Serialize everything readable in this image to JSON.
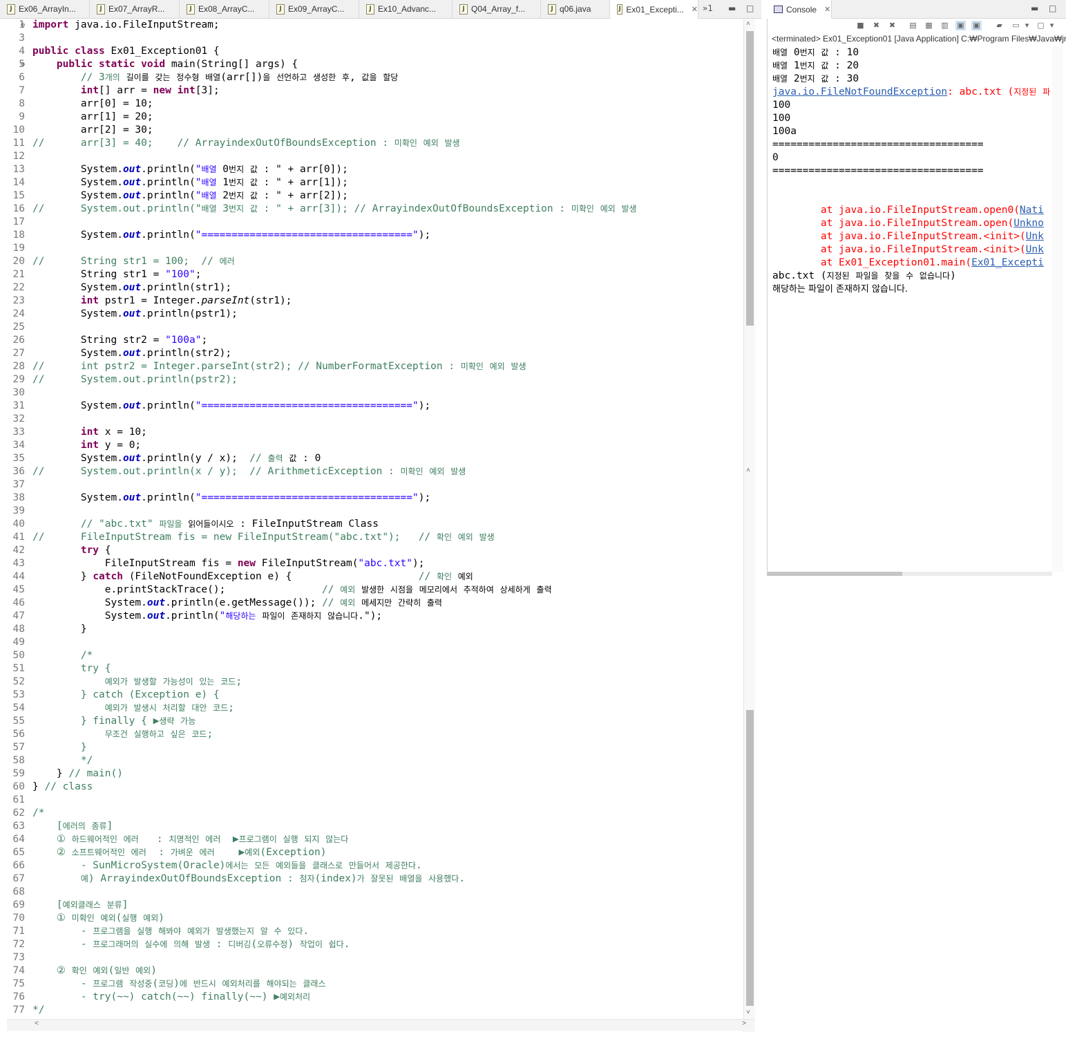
{
  "editor": {
    "tabs": [
      {
        "label": "Ex06_ArrayIn...",
        "active": false
      },
      {
        "label": "Ex07_ArrayR...",
        "active": false
      },
      {
        "label": "Ex08_ArrayC...",
        "active": false
      },
      {
        "label": "Ex09_ArrayC...",
        "active": false
      },
      {
        "label": "Ex10_Advanc...",
        "active": false
      },
      {
        "label": "Q04_Array_f...",
        "active": false
      },
      {
        "label": "q06.java",
        "active": false
      },
      {
        "label": "Ex01_Excepti...",
        "active": true
      }
    ],
    "overflow_label": "»1",
    "tab_close_glyph": "✕",
    "lines": [
      {
        "n": "1",
        "t": "import java.io.FileInputStream;"
      },
      {
        "n": "3",
        "t": ""
      },
      {
        "n": "4",
        "t": "public class Ex01_Exception01 {"
      },
      {
        "n": "5",
        "t": "    public static void main(String[] args) {"
      },
      {
        "n": "6",
        "t": "        // 3개의 길이를 갖는 정수형 배열(arr[])을 선언하고 생성한 후, 값을 할당"
      },
      {
        "n": "7",
        "t": "        int[] arr = new int[3];"
      },
      {
        "n": "8",
        "t": "        arr[0] = 10;"
      },
      {
        "n": "9",
        "t": "        arr[1] = 20;"
      },
      {
        "n": "10",
        "t": "        arr[2] = 30;"
      },
      {
        "n": "11",
        "t": "//      arr[3] = 40;    // ArrayindexOutOfBoundsException : 미확인 예외 발생"
      },
      {
        "n": "12",
        "t": ""
      },
      {
        "n": "13",
        "t": "        System.out.println(\"배열 0번지 값 : \" + arr[0]);"
      },
      {
        "n": "14",
        "t": "        System.out.println(\"배열 1번지 값 : \" + arr[1]);"
      },
      {
        "n": "15",
        "t": "        System.out.println(\"배열 2번지 값 : \" + arr[2]);"
      },
      {
        "n": "16",
        "t": "//      System.out.println(\"배열 3번지 값 : \" + arr[3]); // ArrayindexOutOfBoundsException : 미확인 예외 발생"
      },
      {
        "n": "17",
        "t": ""
      },
      {
        "n": "18",
        "t": "        System.out.println(\"===================================\");"
      },
      {
        "n": "19",
        "t": ""
      },
      {
        "n": "20",
        "t": "//      String str1 = 100;  // 에러"
      },
      {
        "n": "21",
        "t": "        String str1 = \"100\";"
      },
      {
        "n": "22",
        "t": "        System.out.println(str1);"
      },
      {
        "n": "23",
        "t": "        int pstr1 = Integer.parseInt(str1);"
      },
      {
        "n": "24",
        "t": "        System.out.println(pstr1);"
      },
      {
        "n": "25",
        "t": ""
      },
      {
        "n": "26",
        "t": "        String str2 = \"100a\";"
      },
      {
        "n": "27",
        "t": "        System.out.println(str2);"
      },
      {
        "n": "28",
        "t": "//      int pstr2 = Integer.parseInt(str2); // NumberFormatException : 미확인 예외 발생"
      },
      {
        "n": "29",
        "t": "//      System.out.println(pstr2);"
      },
      {
        "n": "30",
        "t": ""
      },
      {
        "n": "31",
        "t": "        System.out.println(\"===================================\");"
      },
      {
        "n": "32",
        "t": ""
      },
      {
        "n": "33",
        "t": "        int x = 10;"
      },
      {
        "n": "34",
        "t": "        int y = 0;"
      },
      {
        "n": "35",
        "t": "        System.out.println(y / x);  // 출력 값 : 0"
      },
      {
        "n": "36",
        "t": "//      System.out.println(x / y);  // ArithmeticException : 미확인 예외 발생"
      },
      {
        "n": "37",
        "t": ""
      },
      {
        "n": "38",
        "t": "        System.out.println(\"===================================\");"
      },
      {
        "n": "39",
        "t": ""
      },
      {
        "n": "40",
        "t": "        // \"abc.txt\" 파일을 읽어들이시오 : FileInputStream Class"
      },
      {
        "n": "41",
        "t": "//      FileInputStream fis = new FileInputStream(\"abc.txt\");   // 확인 예외 발생"
      },
      {
        "n": "42",
        "t": "        try {"
      },
      {
        "n": "43",
        "t": "            FileInputStream fis = new FileInputStream(\"abc.txt\");"
      },
      {
        "n": "44",
        "t": "        } catch (FileNotFoundException e) {                     // 확인 예외"
      },
      {
        "n": "45",
        "t": "            e.printStackTrace();                // 예외 발생한 시점을 메모리에서 추적하여 상세하게 출력"
      },
      {
        "n": "46",
        "t": "            System.out.println(e.getMessage()); // 예외 메세지만 간략히 출력"
      },
      {
        "n": "47",
        "t": "            System.out.println(\"해당하는 파일이 존재하지 않습니다.\");"
      },
      {
        "n": "48",
        "t": "        }"
      },
      {
        "n": "49",
        "t": ""
      },
      {
        "n": "50",
        "t": "        /*"
      },
      {
        "n": "51",
        "t": "        try {"
      },
      {
        "n": "52",
        "t": "            예외가 발생할 가능성이 있는 코드;"
      },
      {
        "n": "53",
        "t": "        } catch (Exception e) {"
      },
      {
        "n": "54",
        "t": "            예외가 발생시 처리할 대안 코드;"
      },
      {
        "n": "55",
        "t": "        } finally { ▶생략 가능"
      },
      {
        "n": "56",
        "t": "            무조건 실행하고 싶은 코드;"
      },
      {
        "n": "57",
        "t": "        }"
      },
      {
        "n": "58",
        "t": "        */"
      },
      {
        "n": "59",
        "t": "    } // main()"
      },
      {
        "n": "60",
        "t": "} // class"
      },
      {
        "n": "61",
        "t": ""
      },
      {
        "n": "62",
        "t": "/*"
      },
      {
        "n": "63",
        "t": "    [에러의 종류]"
      },
      {
        "n": "64",
        "t": "    ① 하드웨어적인 에러   : 치명적인 에러  ▶프로그램이 실행 되지 않는다"
      },
      {
        "n": "65",
        "t": "    ② 소프트웨어적인 에러  : 가벼운 에러    ▶예외(Exception)"
      },
      {
        "n": "66",
        "t": "        - SunMicroSystem(Oracle)에서는 모든 예외들을 클래스로 만들어서 제공한다."
      },
      {
        "n": "67",
        "t": "        예) ArrayindexOutOfBoundsException : 첨자(index)가 잘못된 배열을 사용했다."
      },
      {
        "n": "68",
        "t": ""
      },
      {
        "n": "69",
        "t": "    [예외클래스 분류]"
      },
      {
        "n": "70",
        "t": "    ① 미확인 예외(실행 예외)"
      },
      {
        "n": "71",
        "t": "        - 프로그램을 실행 해봐야 예외가 발생했는지 알 수 있다."
      },
      {
        "n": "72",
        "t": "        - 프로그래머의 실수에 의해 발생 : 디버깅(오류수정) 작업이 쉽다."
      },
      {
        "n": "73",
        "t": ""
      },
      {
        "n": "74",
        "t": "    ② 확인 예외(일반 예외)"
      },
      {
        "n": "75",
        "t": "        - 프로그램 작성중(코딩)에 반드시 예외처리를 해야되는 클래스"
      },
      {
        "n": "76",
        "t": "        - try(~~) catch(~~) finally(~~) ▶예외처리"
      },
      {
        "n": "77",
        "t": "*/"
      }
    ]
  },
  "console": {
    "tab_label": "Console",
    "status": "<terminated> Ex01_Exception01 [Java Application] C:₩Program Files₩Java₩jre",
    "lines": [
      {
        "t": "배열 0번지 값 : 10",
        "type": "out"
      },
      {
        "t": "배열 1번지 값 : 20",
        "type": "out"
      },
      {
        "t": "배열 2번지 값 : 30",
        "type": "out"
      },
      {
        "t": "java.io.FileNotFoundException: abc.txt (지정된 파",
        "type": "err-head"
      },
      {
        "t": "100",
        "type": "out"
      },
      {
        "t": "100",
        "type": "out"
      },
      {
        "t": "100a",
        "type": "out"
      },
      {
        "t": "===================================",
        "type": "out"
      },
      {
        "t": "0",
        "type": "out"
      },
      {
        "t": "===================================",
        "type": "out"
      },
      {
        "t": "",
        "type": "out"
      },
      {
        "t": "",
        "type": "out"
      },
      {
        "t": "        at java.io.FileInputStream.open0(Nati",
        "type": "err"
      },
      {
        "t": "        at java.io.FileInputStream.open(Unkno",
        "type": "err"
      },
      {
        "t": "        at java.io.FileInputStream.<init>(Unk",
        "type": "err"
      },
      {
        "t": "        at java.io.FileInputStream.<init>(Unk",
        "type": "err"
      },
      {
        "t": "        at Ex01_Exception01.main(Ex01_Excepti",
        "type": "err"
      },
      {
        "t": "abc.txt (지정된 파일을 찾을 수 없습니다)",
        "type": "out"
      },
      {
        "t": "해당하는 파일이 존재하지 않습니다.",
        "type": "out-small"
      }
    ]
  }
}
